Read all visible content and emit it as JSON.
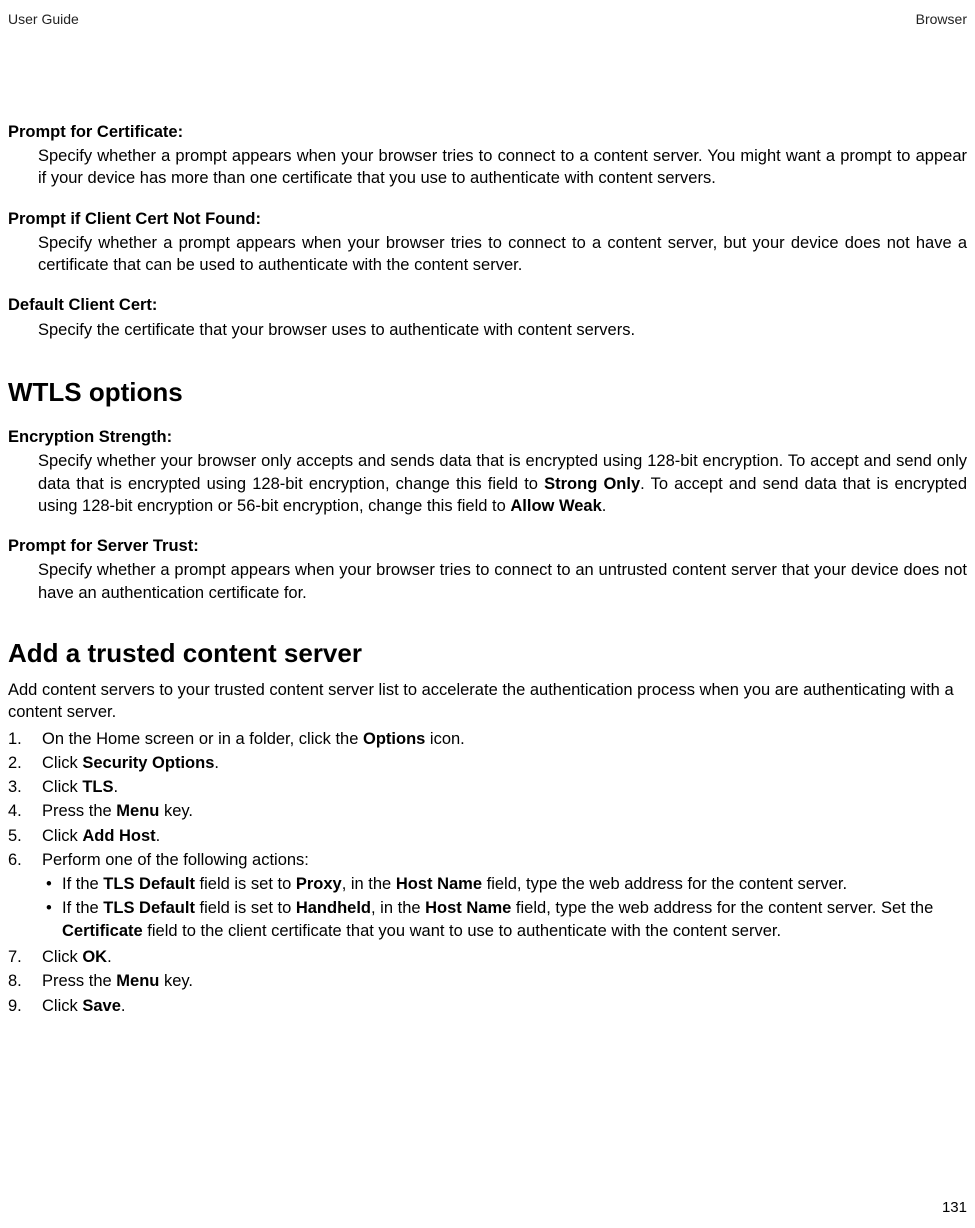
{
  "header": {
    "left": "User Guide",
    "right": "Browser"
  },
  "defs": [
    {
      "title": "Prompt for Certificate:",
      "body_html": "Specify whether a prompt appears when your browser tries to connect to a content server. You might want a prompt to appear if your device has more than one certificate that you use to authenticate with content servers."
    },
    {
      "title": "Prompt if Client Cert Not Found:",
      "body_html": "Specify whether a prompt appears when your browser tries to connect to a content server, but your device does not have a certificate that can be used to authenticate with the content server."
    },
    {
      "title": "Default Client Cert:",
      "body_html": "Specify the certificate that your browser uses to authenticate with content servers."
    }
  ],
  "wtls_heading": "WTLS options",
  "wtls_defs": [
    {
      "title": "Encryption Strength:",
      "body_html": "Specify whether your browser only accepts and sends data that is encrypted using 128-bit encryption. To accept and send only data that is encrypted using 128-bit encryption, change this field to <span class=\"b\">Strong Only</span>. To accept and send data that is encrypted using 128-bit encryption or 56-bit encryption, change this field to <span class=\"b\">Allow Weak</span>."
    },
    {
      "title": "Prompt for Server Trust:",
      "body_html": "Specify whether a prompt appears when your browser tries to connect to an untrusted content server that your device does not have an authentication certificate for."
    }
  ],
  "add_heading": "Add a trusted content server",
  "add_intro": "Add content servers to your trusted content server list to accelerate the authentication process when you are authenticating with a content server.",
  "steps": [
    {
      "num": "1.",
      "html": "On the Home screen or in a folder, click the <span class=\"b\">Options</span> icon."
    },
    {
      "num": "2.",
      "html": "Click <span class=\"b\">Security Options</span>."
    },
    {
      "num": "3.",
      "html": "Click <span class=\"b\">TLS</span>."
    },
    {
      "num": "4.",
      "html": "Press the <span class=\"b\">Menu</span> key."
    },
    {
      "num": "5.",
      "html": "Click <span class=\"b\">Add Host</span>."
    },
    {
      "num": "6.",
      "html": "Perform one of the following actions:",
      "sub": [
        {
          "html": "If the <span class=\"b\">TLS Default</span> field is set to <span class=\"b\">Proxy</span>, in the <span class=\"b\">Host Name</span> field, type the web address for the content server."
        },
        {
          "html": "If the <span class=\"b\">TLS Default</span> field is set to <span class=\"b\">Handheld</span>, in the <span class=\"b\">Host Name</span> field, type the web address for the content server. Set the <span class=\"b\">Certificate</span> field to the client certificate that you want to use to authenticate with the content server."
        }
      ]
    },
    {
      "num": "7.",
      "html": "Click <span class=\"b\">OK</span>."
    },
    {
      "num": "8.",
      "html": "Press the <span class=\"b\">Menu</span> key."
    },
    {
      "num": "9.",
      "html": "Click <span class=\"b\">Save</span>."
    }
  ],
  "page_number": "131"
}
